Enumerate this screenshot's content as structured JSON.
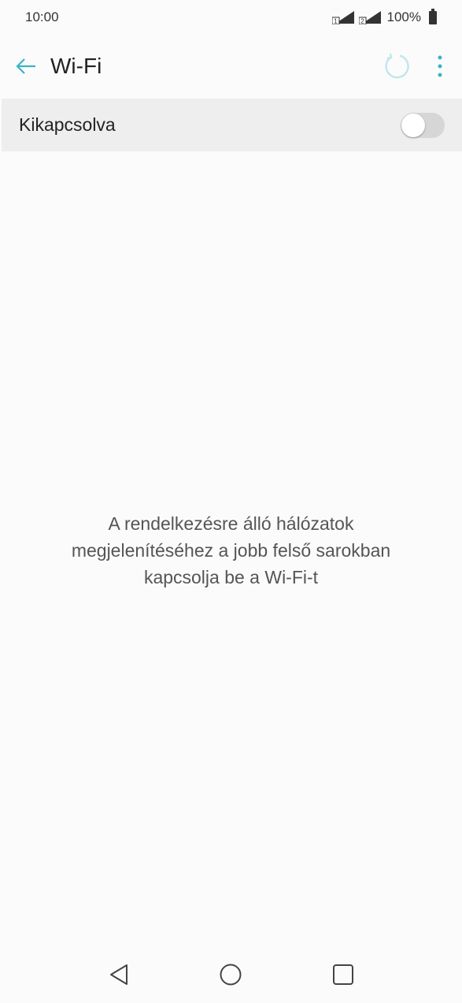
{
  "status_bar": {
    "time": "10:00",
    "battery_percent": "100%",
    "sim1_badge": "1",
    "sim2_badge": "2"
  },
  "app_bar": {
    "title": "Wi-Fi",
    "accent_color": "#3ab5c6"
  },
  "wifi_toggle": {
    "label": "Kikapcsolva",
    "state": "off"
  },
  "hint": {
    "lines": [
      "A rendelkezésre álló hálózatok",
      "megjelenítéséhez a jobb felső sarokban",
      "kapcsolja be a Wi-Fi-t"
    ]
  },
  "nav_bar": {
    "icons": [
      "back-triangle-icon",
      "home-circle-icon",
      "recents-square-icon"
    ]
  }
}
